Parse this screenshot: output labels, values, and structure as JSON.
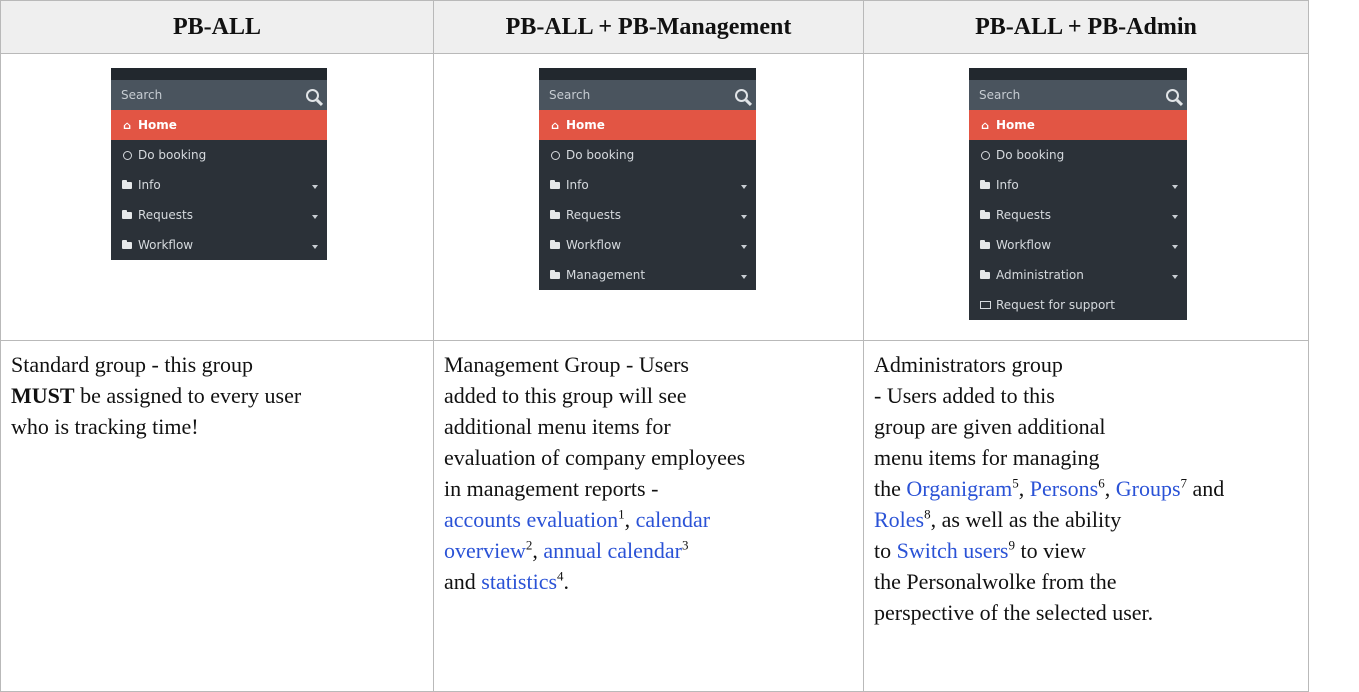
{
  "headers": [
    "PB-ALL",
    "PB-ALL + PB-Management",
    "PB-ALL + PB-Admin"
  ],
  "menus": {
    "all": {
      "search_placeholder": "Search",
      "items": [
        {
          "label": "Home",
          "icon": "home-icon",
          "active": true
        },
        {
          "label": "Do booking",
          "icon": "clock-icon"
        },
        {
          "label": "Info",
          "icon": "folder-icon",
          "expandable": true
        },
        {
          "label": "Requests",
          "icon": "folder-icon",
          "expandable": true
        },
        {
          "label": "Workflow",
          "icon": "folder-icon",
          "expandable": true
        }
      ]
    },
    "management": {
      "search_placeholder": "Search",
      "items": [
        {
          "label": "Home",
          "icon": "home-icon",
          "active": true
        },
        {
          "label": "Do booking",
          "icon": "clock-icon"
        },
        {
          "label": "Info",
          "icon": "folder-icon",
          "expandable": true
        },
        {
          "label": "Requests",
          "icon": "folder-icon",
          "expandable": true
        },
        {
          "label": "Workflow",
          "icon": "folder-icon",
          "expandable": true
        },
        {
          "label": "Management",
          "icon": "folder-icon",
          "expandable": true
        }
      ]
    },
    "admin": {
      "search_placeholder": "Search",
      "items": [
        {
          "label": "Home",
          "icon": "home-icon",
          "active": true
        },
        {
          "label": "Do booking",
          "icon": "clock-icon"
        },
        {
          "label": "Info",
          "icon": "folder-icon",
          "expandable": true
        },
        {
          "label": "Requests",
          "icon": "folder-icon",
          "expandable": true
        },
        {
          "label": "Workflow",
          "icon": "folder-icon",
          "expandable": true
        },
        {
          "label": "Administration",
          "icon": "folder-icon",
          "expandable": true
        },
        {
          "label": "Request for support",
          "icon": "monitor-icon"
        }
      ]
    }
  },
  "descriptions": {
    "all": {
      "t1": "Standard group - this group",
      "must": "MUST",
      "t2": " be assigned to every user",
      "t3": "who is tracking time!"
    },
    "management": {
      "l1": "Management Group - Users",
      "l2": "added to this group will see",
      "l3": "additional menu items for",
      "l4": "evaluation of company employees",
      "l5": "in management reports -",
      "link1": "accounts evaluation",
      "fn1": "1",
      "link2a": "calendar",
      "link2b": "overview",
      "fn2": "2",
      "link3": "annual calendar",
      "fn3": "3",
      "and": "and ",
      "link4": "statistics",
      "fn4": "4",
      "end": "."
    },
    "admin": {
      "l1": "Administrators group",
      "l2": "- Users added to this",
      "l3": "group are given additional",
      "l4": "menu items for managing",
      "the": "the ",
      "link5": "Organigram",
      "fn5": "5",
      "link6": "Persons",
      "fn6": "6",
      "link7": "Groups",
      "fn7": "7",
      "and": " and",
      "link8": "Roles",
      "fn8": "8",
      "l6tail": ", as well as the ability",
      "to": "to ",
      "link9": "Switch users",
      "fn9": "9",
      "l7tail": " to view",
      "l8": "the Personalwolke from the",
      "l9": "perspective of the selected user."
    }
  },
  "colors": {
    "menu_bg": "#2b3138",
    "search_bg": "#4a545e",
    "active": "#e25544",
    "link": "#2a52d6",
    "header_bg": "#efefef"
  }
}
